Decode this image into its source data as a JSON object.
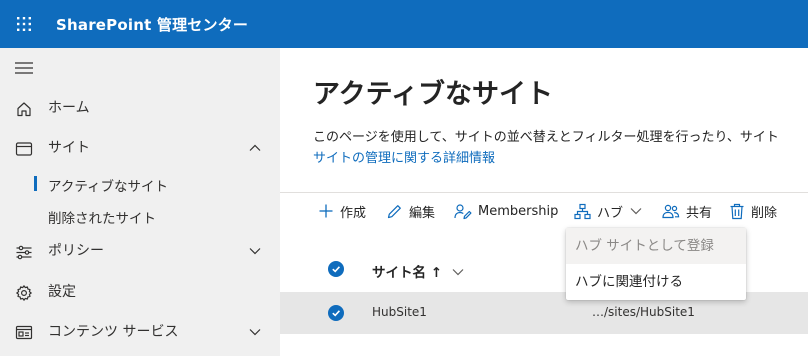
{
  "app": {
    "title": "SharePoint 管理センター"
  },
  "sidebar": {
    "items": [
      {
        "label": "ホーム",
        "icon": "home-icon"
      },
      {
        "label": "サイト",
        "icon": "window-icon",
        "expanded": true
      },
      {
        "label": "ポリシー",
        "icon": "sliders-icon",
        "expanded": false
      },
      {
        "label": "設定",
        "icon": "gear-icon"
      },
      {
        "label": "コンテンツ サービス",
        "icon": "content-services-icon",
        "expanded": false
      }
    ],
    "sub_items": [
      {
        "label": "アクティブなサイト",
        "selected": true
      },
      {
        "label": "削除されたサイト",
        "selected": false
      }
    ]
  },
  "main": {
    "title": "アクティブなサイト",
    "description": "このページを使用して、サイトの並べ替えとフィルター処理を行ったり、サイト",
    "link_text": "サイトの管理に関する詳細情報"
  },
  "toolbar": {
    "create": "作成",
    "edit": "編集",
    "membership": "Membership",
    "hub": "ハブ",
    "share": "共有",
    "delete": "削除"
  },
  "table": {
    "columns": [
      {
        "label": "サイト名 ↑"
      }
    ],
    "rows": [
      {
        "name": "HubSite1",
        "url": "…/sites/HubSite1",
        "selected": true
      }
    ]
  },
  "hub_menu": {
    "items": [
      {
        "label": "ハブ サイトとして登録",
        "disabled": true
      },
      {
        "label": "ハブに関連付ける",
        "disabled": false
      }
    ]
  },
  "colors": {
    "accent": "#0f6cbd",
    "sidebar_bg": "#f0f0f0",
    "selected_row": "#e6e6e6"
  }
}
